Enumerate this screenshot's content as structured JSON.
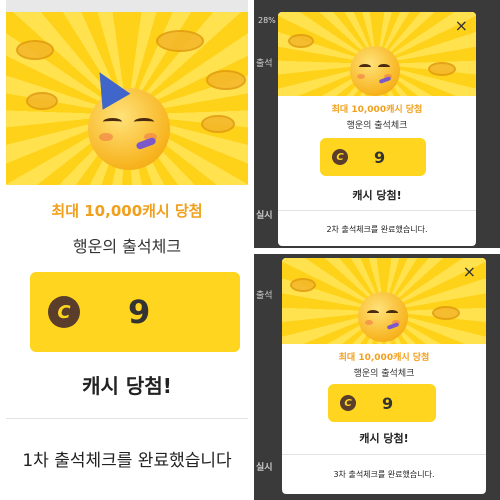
{
  "panels": [
    {
      "title": "최대 10,000캐시 당첨",
      "subtitle": "행운의 출석체크",
      "cash_value": "9",
      "coin_letter": "C",
      "win_text": "캐시 당첨!",
      "complete_text": "1차 출석체크를 완료했습니다"
    },
    {
      "title": "최대 10,000캐시 당첨",
      "subtitle": "행운의 출석체크",
      "cash_value": "9",
      "coin_letter": "C",
      "win_text": "캐시 당첨!",
      "complete_text": "2차 출석체크를 완료했습니다.",
      "close_icon": "×"
    },
    {
      "title": "최대 10,000캐시 당첨",
      "subtitle": "행운의 출석체크",
      "cash_value": "9",
      "coin_letter": "C",
      "win_text": "캐시 당첨!",
      "complete_text": "3차 출석체크를 완료했습니다.",
      "close_icon": "×"
    }
  ],
  "background_fragments": {
    "top_right_percent": "28%",
    "side_text_1": "출석",
    "side_text_2": "실시",
    "side_text_3": "출석",
    "side_text_4": "실시"
  },
  "colors": {
    "accent_orange": "#f0a01c",
    "cash_yellow": "#ffd51f",
    "coin_brown": "#5a3e2b"
  }
}
